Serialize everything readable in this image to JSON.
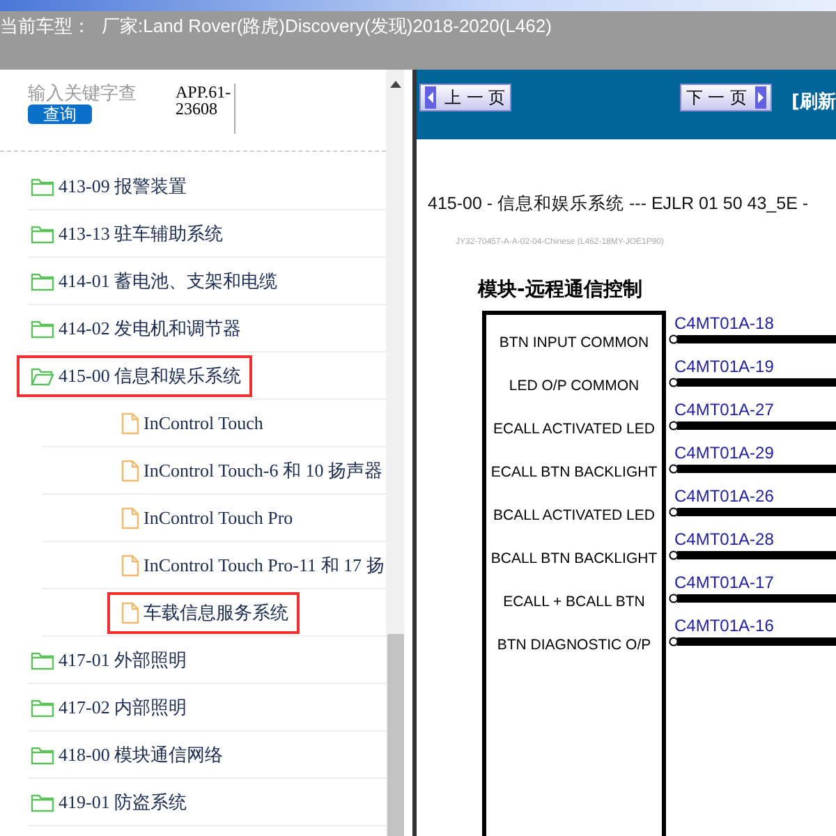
{
  "header": {
    "label": "当前车型：",
    "value": "厂家:Land Rover(路虎)Discovery(发现)2018-2020(L462)"
  },
  "search": {
    "placeholder": "输入关键字查",
    "button": "查询",
    "code": "APP.61-23608"
  },
  "tree": [
    {
      "label": "413-09 报警装置",
      "expanded": false,
      "highlighted": false
    },
    {
      "label": "413-13 驻车辅助系统",
      "expanded": false,
      "highlighted": false
    },
    {
      "label": "414-01 蓄电池、支架和电缆",
      "expanded": false,
      "highlighted": false
    },
    {
      "label": "414-02 发电机和调节器",
      "expanded": false,
      "highlighted": false
    },
    {
      "label": "415-00 信息和娱乐系统",
      "expanded": true,
      "highlighted": true,
      "children": [
        {
          "label": "InControl Touch",
          "highlighted": false
        },
        {
          "label": "InControl Touch-6 和 10 扬声器",
          "highlighted": false
        },
        {
          "label": "InControl Touch Pro",
          "highlighted": false
        },
        {
          "label": "InControl Touch Pro-11 和 17 扬",
          "highlighted": false
        },
        {
          "label": "车载信息服务系统",
          "highlighted": true
        }
      ]
    },
    {
      "label": "417-01 外部照明",
      "expanded": false,
      "highlighted": false
    },
    {
      "label": "417-02 内部照明",
      "expanded": false,
      "highlighted": false
    },
    {
      "label": "418-00 模块通信网络",
      "expanded": false,
      "highlighted": false
    },
    {
      "label": "419-01 防盗系统",
      "expanded": false,
      "highlighted": false
    }
  ],
  "toolbar": {
    "prev": "上 一 页",
    "next": "下 一 页",
    "refresh": "[刷新"
  },
  "document": {
    "title": "415-00 - 信息和娱乐系统 --- EJLR 01 50 43_5E -",
    "reference": "JY32-70457-A-A-02-04-Chinese (L462-18MY-JOE1P90)",
    "module": "模块-远程通信控制",
    "pins": [
      {
        "name": "BTN INPUT COMMON",
        "connector": "C4MT01A-18"
      },
      {
        "name": "LED O/P COMMON",
        "connector": "C4MT01A-19"
      },
      {
        "name": "ECALL ACTIVATED LED",
        "connector": "C4MT01A-27"
      },
      {
        "name": "ECALL BTN BACKLIGHT",
        "connector": "C4MT01A-29"
      },
      {
        "name": "BCALL ACTIVATED LED",
        "connector": "C4MT01A-26"
      },
      {
        "name": "BCALL BTN BACKLIGHT",
        "connector": "C4MT01A-28"
      },
      {
        "name": "ECALL + BCALL BTN",
        "connector": "C4MT01A-17"
      },
      {
        "name": "BTN DIAGNOSTIC O/P",
        "connector": "C4MT01A-16"
      }
    ]
  }
}
